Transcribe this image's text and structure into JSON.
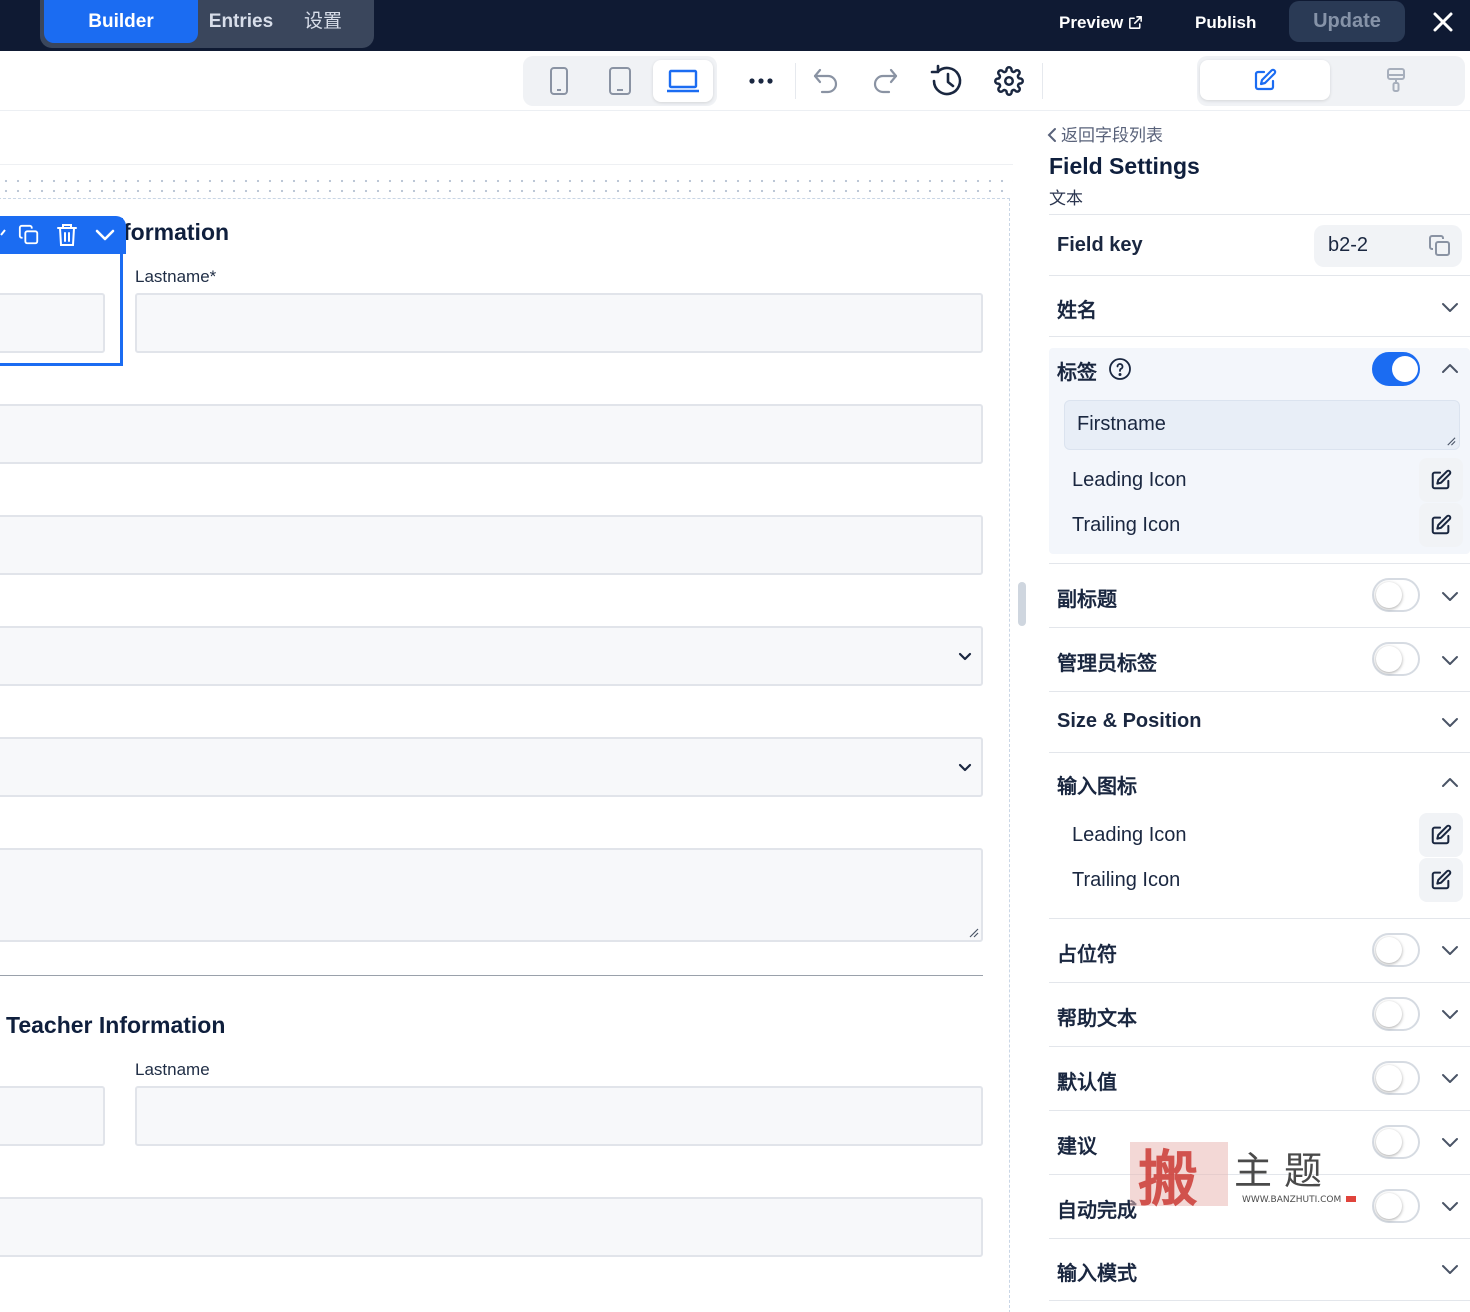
{
  "topbar": {
    "tabs": [
      "Builder",
      "Entries",
      "设置"
    ],
    "preview": "Preview",
    "publish": "Publish",
    "update": "Update"
  },
  "toolbar": {
    "devices": [
      "mobile-icon",
      "tablet-icon",
      "laptop-icon"
    ],
    "active_device": "laptop",
    "tools": [
      "more-icon",
      "undo-icon",
      "redo-icon",
      "history-icon",
      "settings-gear-icon"
    ],
    "panel_modes": [
      "edit-pencil-icon",
      "paint-brush-icon"
    ]
  },
  "canvas": {
    "section1_title": "formation",
    "section1_lastname_label": "Lastname*",
    "section2_title": "Teacher Information",
    "section2_lastname_label": "Lastname"
  },
  "panel": {
    "back": "返回字段列表",
    "title": "Field Settings",
    "subtitle": "文本",
    "field_key_label": "Field key",
    "field_key_value": "b2-2",
    "name_label": "姓名",
    "tag_label": "标签",
    "tag_enabled": true,
    "label_value": "Firstname",
    "leading_icon": "Leading Icon",
    "trailing_icon": "Trailing Icon",
    "subtitle_label": "副标题",
    "admin_label": "管理员标签",
    "size_position": "Size & Position",
    "input_icon": "输入图标",
    "leading_icon_2": "Leading Icon",
    "trailing_icon_2": "Trailing Icon",
    "placeholder": "占位符",
    "help_text": "帮助文本",
    "default_value": "默认值",
    "suggestion": "建议",
    "autocomplete": "自动完成",
    "input_mode": "输入模式"
  },
  "colors": {
    "accent": "#1b6cf2",
    "topbar_bg": "#0f1a33"
  },
  "watermark": {
    "text": "搬主题",
    "url": "WWW.BANZHUTI.COM"
  }
}
